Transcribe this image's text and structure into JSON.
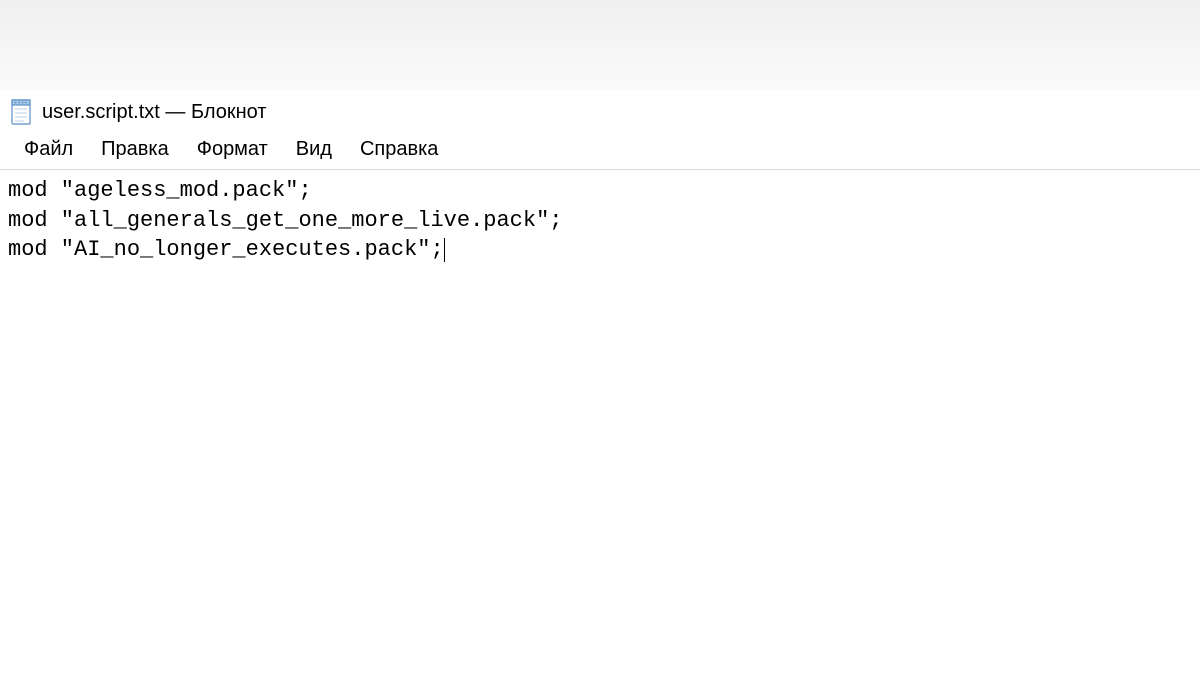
{
  "window": {
    "filename": "user.script.txt",
    "app_name": "Блокнот",
    "title_separator": " — "
  },
  "menu": {
    "items": [
      {
        "label": "Файл"
      },
      {
        "label": "Правка"
      },
      {
        "label": "Формат"
      },
      {
        "label": "Вид"
      },
      {
        "label": "Справка"
      }
    ]
  },
  "editor": {
    "lines": [
      "mod \"ageless_mod.pack\";",
      "mod \"all_generals_get_one_more_live.pack\";",
      "mod \"AI_no_longer_executes.pack\";"
    ]
  },
  "icons": {
    "notepad": "notepad-icon"
  }
}
